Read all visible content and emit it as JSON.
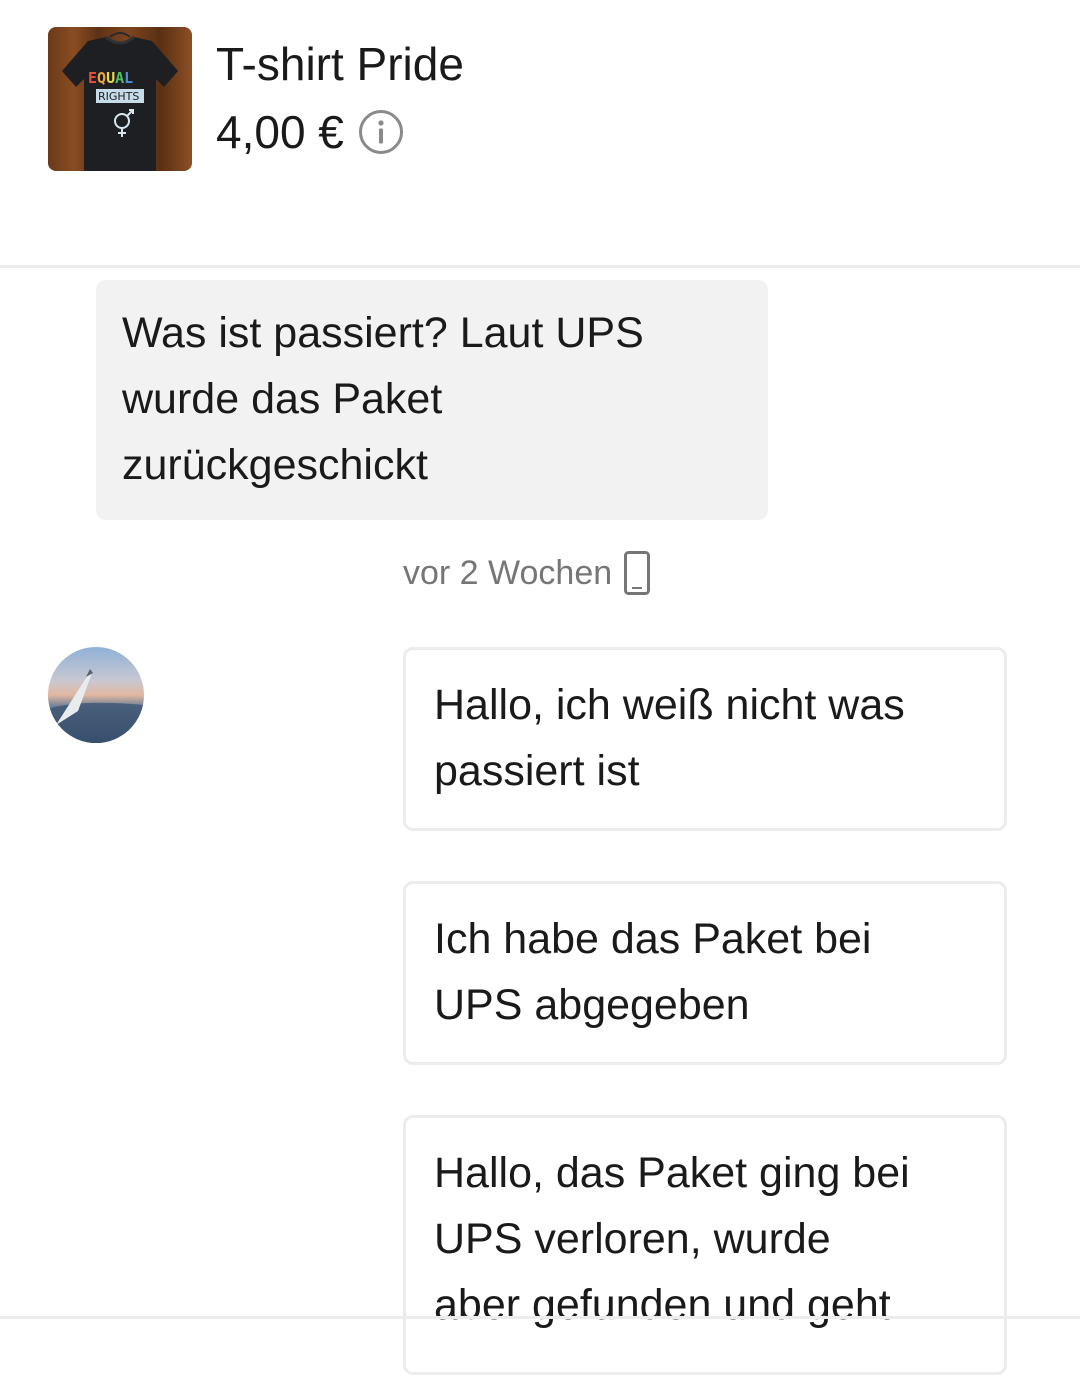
{
  "item": {
    "title": "T-shirt Pride",
    "price": "4,00 €",
    "thumbnail_icon": "tshirt-photo",
    "shirt_print_line1": "EQUAL",
    "shirt_print_line2": "RIGHTS"
  },
  "messages": [
    {
      "direction": "incoming",
      "text": "Was ist passiert? Laut UPS\nwurde das Paket\nzurückgeschickt"
    },
    {
      "direction": "outgoing",
      "text": "Hallo, ich weiß nicht was\npassiert ist"
    },
    {
      "direction": "outgoing",
      "text": "Ich habe das Paket bei\nUPS abgegeben"
    },
    {
      "direction": "outgoing",
      "text": "Hallo, das Paket ging bei\nUPS verloren, wurde\naber gefunden und geht"
    }
  ],
  "timestamp": {
    "label": "vor 2 Wochen",
    "icon": "phone-icon"
  },
  "colors": {
    "incoming_bubble": "#f2f2f2",
    "outgoing_border": "#ececec",
    "timestamp_text": "#767676",
    "text": "#1a1a1a"
  }
}
